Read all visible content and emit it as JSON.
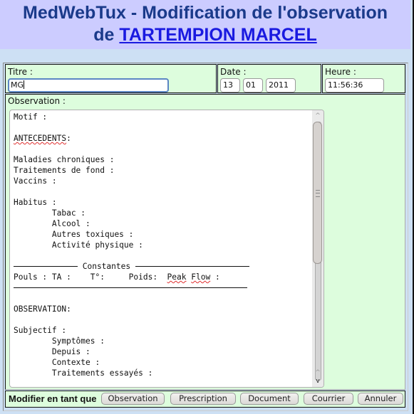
{
  "header": {
    "title_line1": "MedWebTux - Modification de l'observation",
    "title_prefix": "de",
    "patient_name": "TARTEMPION MARCEL"
  },
  "form": {
    "titre": {
      "label": "Titre :",
      "value": "MG"
    },
    "date": {
      "label": "Date :",
      "day": "13",
      "month": "01",
      "year": "2011"
    },
    "heure": {
      "label": "Heure :",
      "value": "11:56:36"
    },
    "observation": {
      "label": "Observation :",
      "lines": {
        "motif": "Motif :",
        "antecedents": "ANTECEDENTS",
        "antecedents_colon": ":",
        "maladies": "Maladies chroniques :",
        "traitements_fond": "Traitements de fond :",
        "vaccins": "Vaccins :",
        "habitus": "Habitus :",
        "tabac": "        Tabac :",
        "alcool": "        Alcool :",
        "autres_toxiques": "        Autres toxiques :",
        "activite": "        Activité physique :",
        "constantes": " Constantes ",
        "pouls_ta": "Pouls : TA :    T°:     Poids:  ",
        "peak": "Peak",
        "flow": "Flow",
        "flow_colon": " :",
        "observation_header": "OBSERVATION:",
        "subjectif": "Subjectif :",
        "symptomes": "        Symptômes :",
        "depuis": "        Depuis :",
        "contexte": "        Contexte :",
        "traitements_essayes": "        Traitements essayés :"
      }
    }
  },
  "footer": {
    "label": "Modifier en tant que",
    "buttons": {
      "observation": "Observation",
      "prescription": "Prescription",
      "document": "Document",
      "courrier": "Courrier",
      "annuler": "Annuler"
    }
  },
  "icons": {
    "scroll_up": "^",
    "scroll_down": "v"
  }
}
